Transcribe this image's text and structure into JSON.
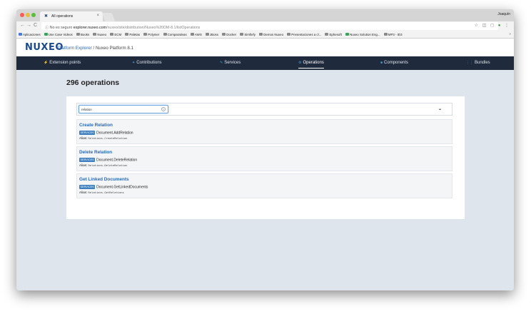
{
  "browser": {
    "tab_title": "All operations",
    "tab_close": "×",
    "user_name": "Joaquín",
    "url_security": "No es seguro",
    "url_host": "explorer.nuxeo.com",
    "url_path": "/nuxeo/site/distribution/Nuxeo%20DM-8.1/listOperations",
    "nav_back": "←",
    "nav_forward": "→",
    "nav_reload": "C",
    "toolbar_icons": "☆ ◫ ◻",
    "bookmarks": [
      "Aplicaciones",
      "Use Case Videos",
      "Books",
      "Nuxeo",
      "ECM",
      "Paletas",
      "Polymer",
      "Comparativas",
      "AWS",
      "JBoss",
      "Docker",
      "Simfiefy",
      "Demos Nuxeo",
      "Presentaciones a cl...",
      "Ephesoft",
      "Nuxeo Solution Eng...",
      "MP3 - ID3"
    ],
    "bookmarks_more": "»"
  },
  "header": {
    "logo": "NUXEO",
    "breadcrumb_link": "Platform Explorer",
    "breadcrumb_rest": " / Nuxeo Platform 8.1"
  },
  "nav": {
    "items": [
      {
        "label": "Extension points",
        "icon": "plug-icon"
      },
      {
        "label": "Contributions",
        "icon": "puzzle-icon"
      },
      {
        "label": "Services",
        "icon": "wrench-icon"
      },
      {
        "label": "Operations",
        "icon": "cog-icon"
      },
      {
        "label": "Components",
        "icon": "cube-icon"
      },
      {
        "label": "Bundles",
        "icon": "bundle-icon"
      }
    ],
    "active": "Operations"
  },
  "main": {
    "title": "296 operations",
    "search": {
      "value": "relation",
      "placeholder": ""
    },
    "operations": [
      {
        "title": "Create Relation",
        "badge": "SERVICES",
        "id": "Document.AddRelation",
        "alias_label": "Alias:",
        "alias": "Relations.CreateRelation"
      },
      {
        "title": "Delete Relation",
        "badge": "SERVICES",
        "id": "Document.DeleteRelation",
        "alias_label": "Alias:",
        "alias": "Relations.DeleteRelation"
      },
      {
        "title": "Get Linked Documents",
        "badge": "SERVICES",
        "id": "Document.GetLinkedDocuments",
        "alias_label": "Alias:",
        "alias": "Relations.GetRelations"
      }
    ]
  },
  "colors": {
    "navbar": "#1f2a3c",
    "accent": "#2a6ab8",
    "badge": "#3f7fbf",
    "background": "#dfe5ed"
  }
}
